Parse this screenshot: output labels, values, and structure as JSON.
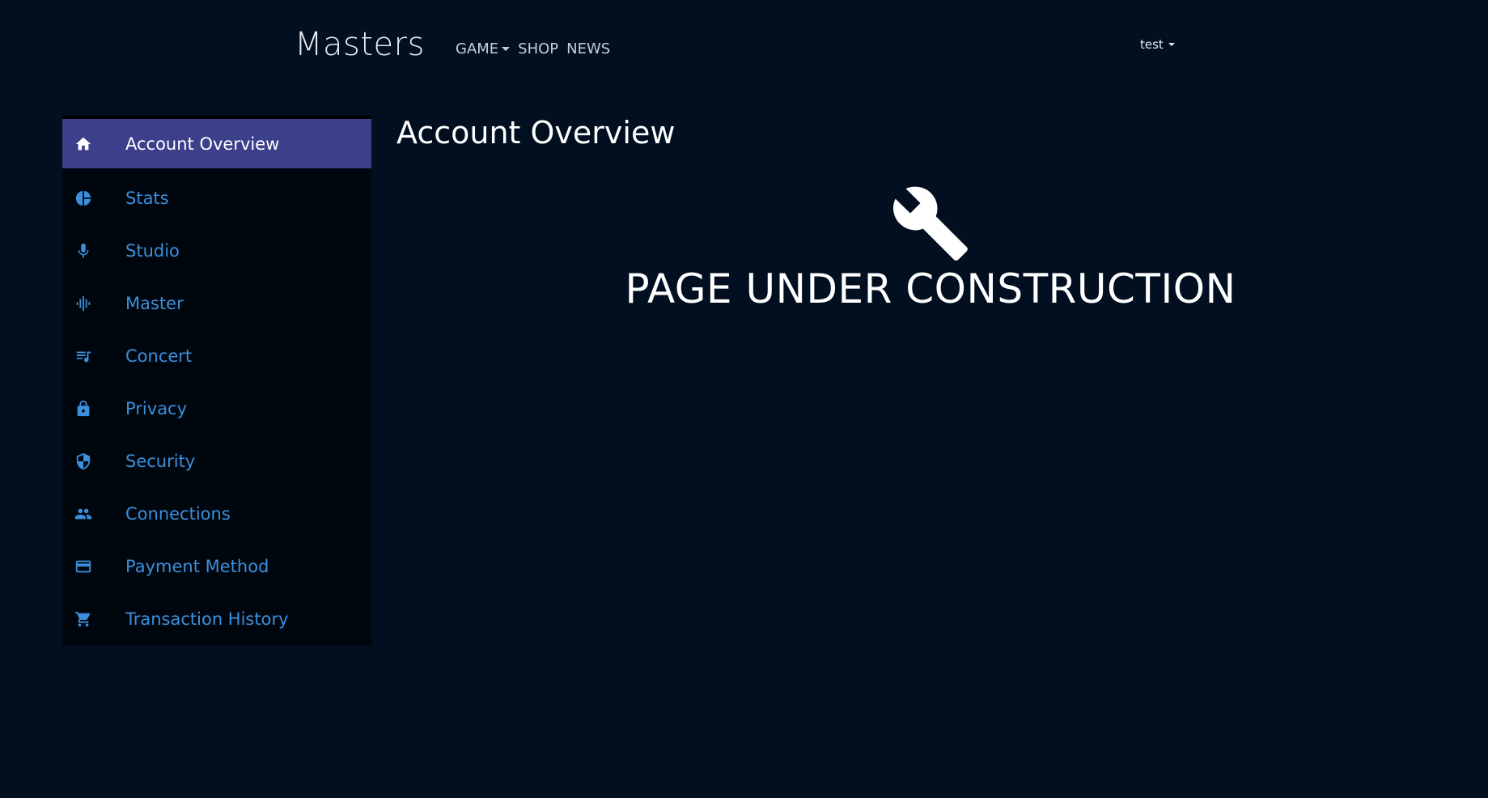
{
  "header": {
    "brand": "Masters",
    "nav": [
      {
        "label": "GAME",
        "dropdown": true
      },
      {
        "label": "SHOP"
      },
      {
        "label": "NEWS"
      }
    ],
    "user": "test"
  },
  "sidebar": {
    "items": [
      {
        "label": "Account Overview",
        "icon": "home-icon",
        "active": true
      },
      {
        "label": "Stats",
        "icon": "pie-chart-icon"
      },
      {
        "label": "Studio",
        "icon": "microphone-icon"
      },
      {
        "label": "Master",
        "icon": "waveform-icon"
      },
      {
        "label": "Concert",
        "icon": "queue-music-icon"
      },
      {
        "label": "Privacy",
        "icon": "lock-icon"
      },
      {
        "label": "Security",
        "icon": "shield-icon"
      },
      {
        "label": "Connections",
        "icon": "people-icon"
      },
      {
        "label": "Payment Method",
        "icon": "credit-card-icon"
      },
      {
        "label": "Transaction History",
        "icon": "shopping-cart-icon"
      }
    ]
  },
  "main": {
    "title": "Account Overview",
    "construction_icon": "wrench-icon",
    "construction_text": "PAGE UNDER CONSTRUCTION"
  },
  "colors": {
    "background": "#010f21",
    "sidebar_bg": "#00060d",
    "active_bg": "#3c3f8a",
    "link": "#3b8fdc"
  }
}
